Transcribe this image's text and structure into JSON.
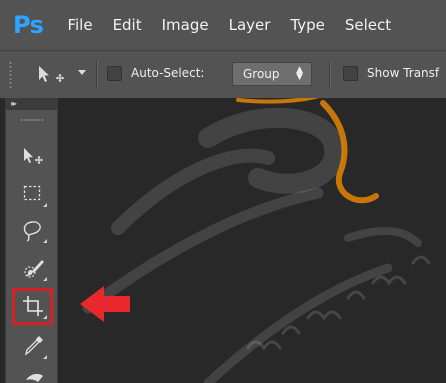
{
  "app": {
    "logo": "Ps"
  },
  "menu": {
    "items": [
      {
        "label": "File"
      },
      {
        "label": "Edit"
      },
      {
        "label": "Image"
      },
      {
        "label": "Layer"
      },
      {
        "label": "Type"
      },
      {
        "label": "Select"
      }
    ]
  },
  "options": {
    "auto_select_label": "Auto-Select:",
    "auto_select_checked": false,
    "group_value": "Group",
    "show_transform_label": "Show Transf",
    "show_transform_checked": false
  },
  "toolbar": {
    "collapse_glyph": "▸▸",
    "tools": [
      {
        "name": "move-tool",
        "icon": "move-icon"
      },
      {
        "name": "rectangular-marquee-tool",
        "icon": "marquee-icon"
      },
      {
        "name": "lasso-tool",
        "icon": "lasso-icon"
      },
      {
        "name": "quick-selection-tool",
        "icon": "quick-selection-icon"
      },
      {
        "name": "crop-tool",
        "icon": "crop-icon",
        "highlighted": true
      },
      {
        "name": "eyedropper-tool",
        "icon": "eyedropper-icon"
      },
      {
        "name": "spot-healing-tool",
        "icon": "spot-healing-icon"
      }
    ]
  },
  "colors": {
    "ps_logo": "#2fa3ff",
    "chrome": "#535353",
    "canvas": "#282828",
    "highlight": "#d82027",
    "arrow": "#e8282d",
    "watermark_orange": "#f08a00"
  }
}
